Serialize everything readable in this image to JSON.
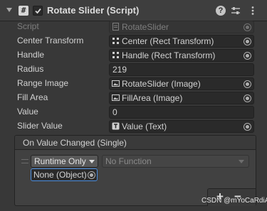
{
  "header": {
    "title": "Rotate Slider (Script)",
    "enabled": true,
    "help_icon_glyph": "?",
    "script_icon_glyph": "#"
  },
  "properties": [
    {
      "label": "Script",
      "value": "RotateSlider",
      "icon": "script-file-icon",
      "disabled": true
    },
    {
      "label": "Center Transform",
      "value": "Center (Rect Transform)",
      "icon": "rect-transform-icon",
      "picker": true
    },
    {
      "label": "Handle",
      "value": "Handle (Rect Transform)",
      "icon": "rect-transform-icon",
      "picker": true
    },
    {
      "label": "Radius",
      "value": "219"
    },
    {
      "label": "Range Image",
      "value": "RotateSlider (Image)",
      "icon": "image-icon",
      "picker": true
    },
    {
      "label": "Fill Area",
      "value": "FillArea (Image)",
      "icon": "image-icon",
      "picker": true
    },
    {
      "label": "Value",
      "value": "0"
    },
    {
      "label": "Slider Value",
      "value": "Value (Text)",
      "icon": "text-icon",
      "picker": true
    }
  ],
  "event": {
    "title": "On Value Changed (Single)",
    "call_state": "Runtime Only",
    "function": "No Function",
    "target": "None (Object)",
    "add_glyph": "+",
    "remove_glyph": "−"
  },
  "watermark": "CSDN @mYoCaRdiA",
  "colors": {
    "background": "#383838",
    "header": "#3e3e3e",
    "field": "#2a2a2a",
    "focus_border": "#4c8fe0",
    "text": "#d2d2d2",
    "disabled_text": "#7e7e7e"
  }
}
